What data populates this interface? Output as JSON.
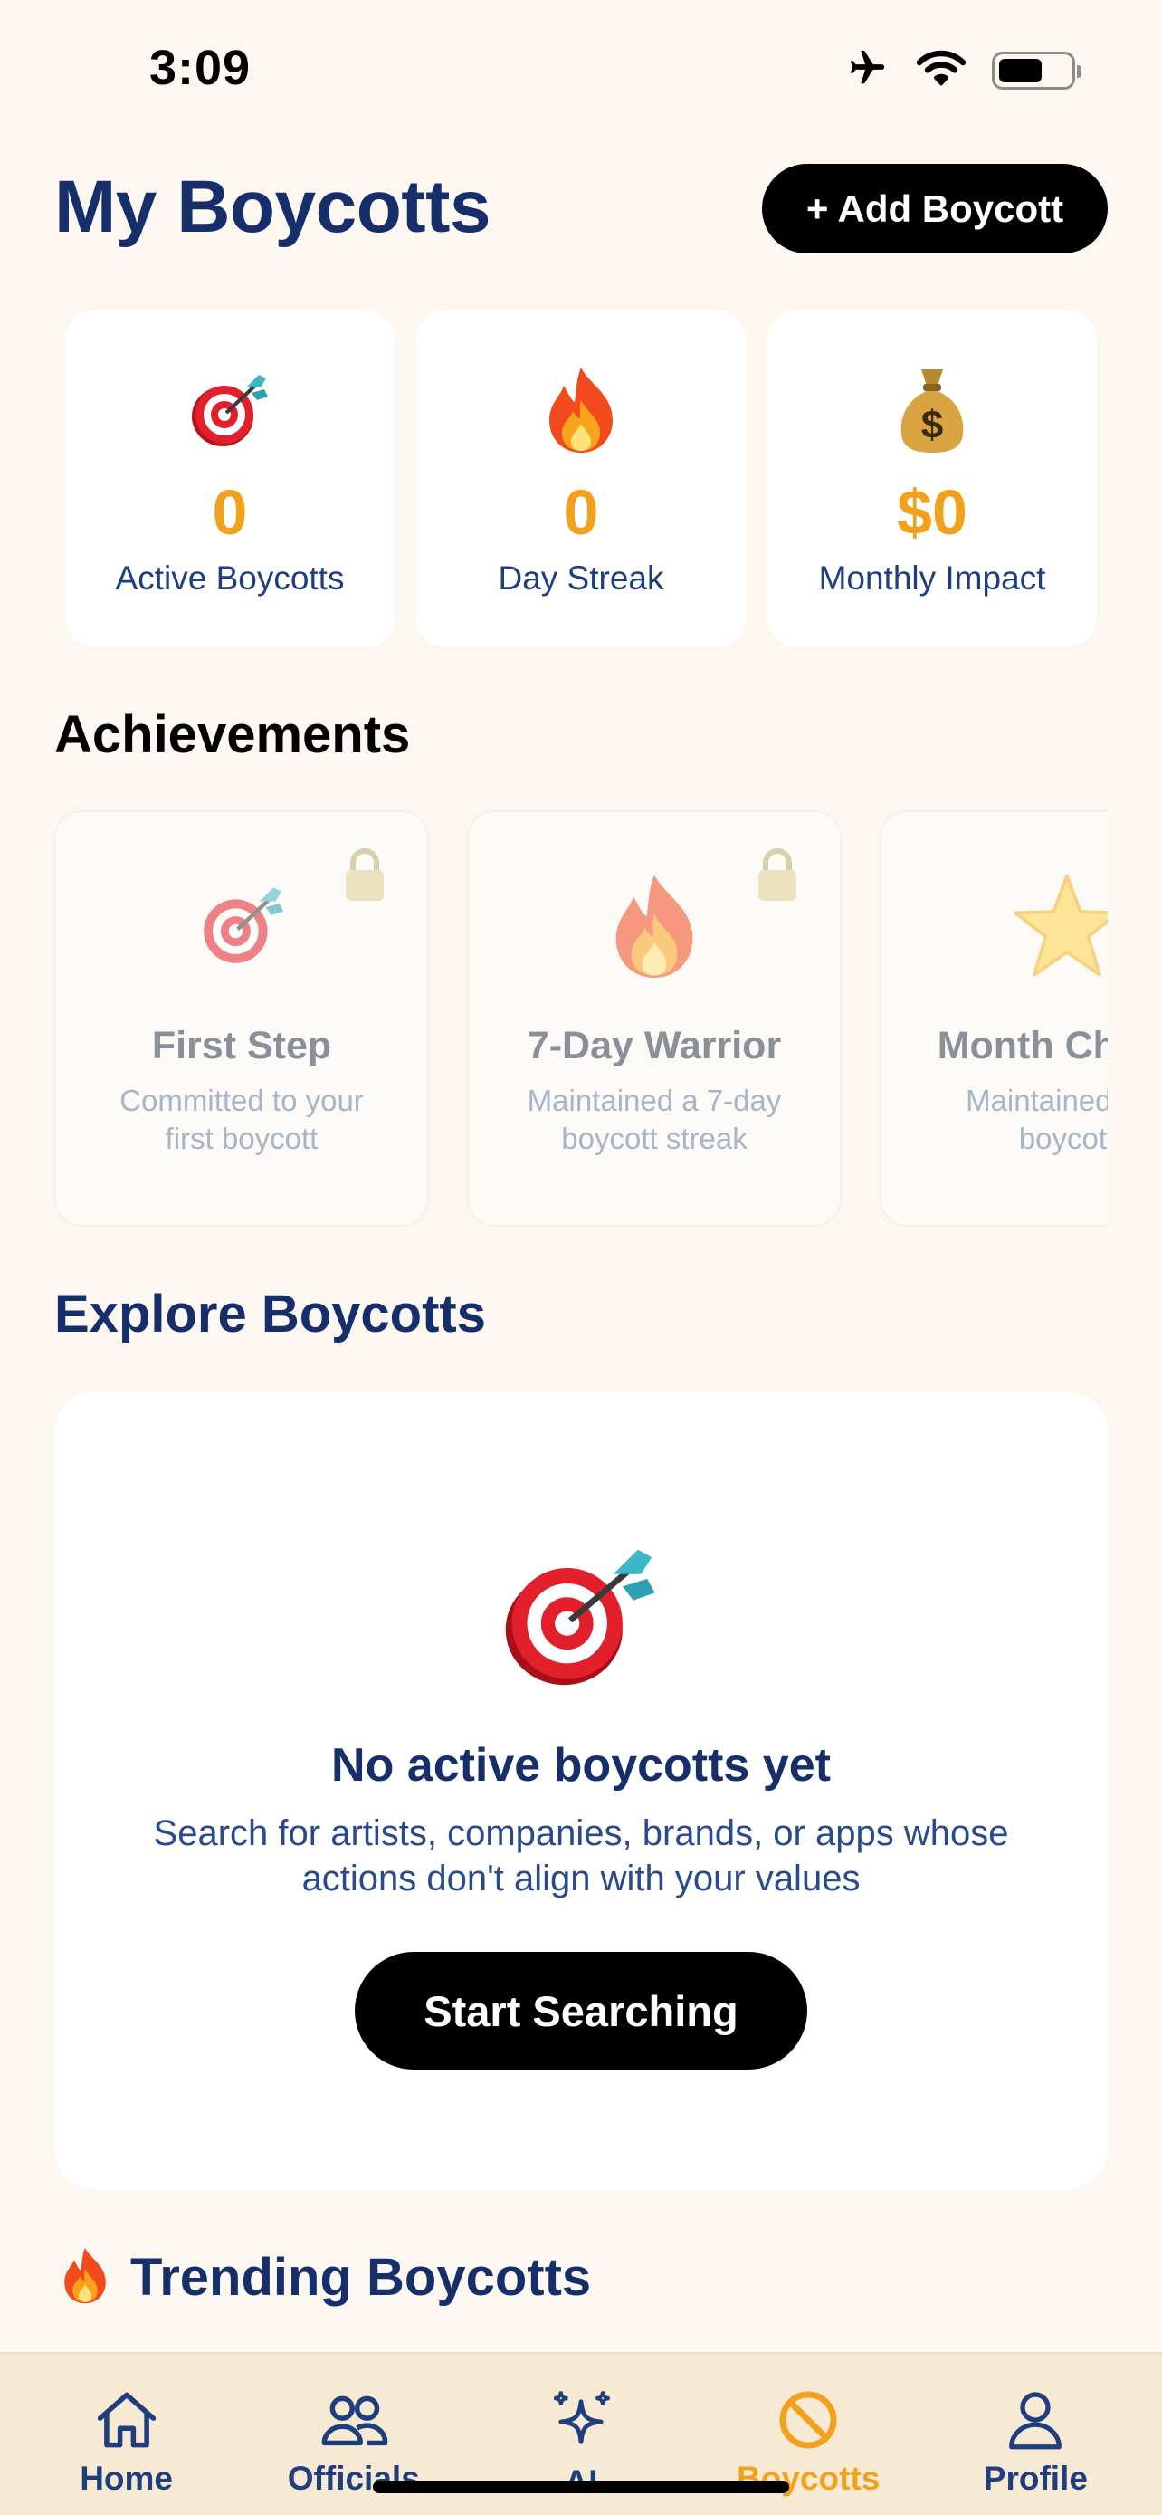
{
  "status_bar": {
    "time": "3:09"
  },
  "header": {
    "title": "My Boycotts",
    "add_button_label": "+ Add Boycott"
  },
  "stats": [
    {
      "icon": "target-dart-icon",
      "value": "0",
      "label": "Active Boycotts"
    },
    {
      "icon": "fire-icon",
      "value": "0",
      "label": "Day Streak"
    },
    {
      "icon": "money-bag-icon",
      "value": "$0",
      "label": "Monthly Impact"
    }
  ],
  "achievements": {
    "title": "Achievements",
    "items": [
      {
        "icon": "target-dart-icon",
        "title": "First Step",
        "description": "Committed to your first boycott",
        "locked": true
      },
      {
        "icon": "fire-icon",
        "title": "7-Day Warrior",
        "description": "Maintained a 7-day boycott streak",
        "locked": true
      },
      {
        "icon": "star-icon",
        "title": "Month Champ",
        "description": "Maintained day boycott",
        "locked": true
      }
    ]
  },
  "explore": {
    "title": "Explore Boycotts",
    "empty_title": "No active boycotts yet",
    "empty_text": "Search for artists, companies, brands, or apps whose actions don't align with your values",
    "button_label": "Start Searching"
  },
  "trending": {
    "title": "Trending Boycotts"
  },
  "tabs": [
    {
      "label": "Home",
      "icon": "home-icon",
      "active": false
    },
    {
      "label": "Officials",
      "icon": "people-icon",
      "active": false
    },
    {
      "label": "AI",
      "icon": "sparkles-icon",
      "active": false
    },
    {
      "label": "Boycotts",
      "icon": "prohibited-icon",
      "active": true
    },
    {
      "label": "Profile",
      "icon": "person-icon",
      "active": false
    }
  ],
  "colors": {
    "accent": "#f2a11d",
    "navy": "#162f6a",
    "background": "#fcf8f1",
    "tab_bar": "#f6ead5"
  }
}
